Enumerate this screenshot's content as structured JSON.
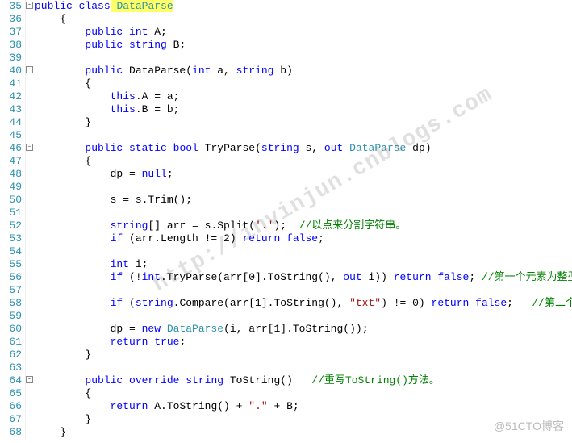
{
  "lines": {
    "l35": {
      "n": "35",
      "f": "⊟",
      "a": "public",
      "b": "class",
      "c": " DataParse"
    },
    "l36": {
      "n": "36",
      "t": "    {"
    },
    "l37": {
      "n": "37",
      "a": "        public",
      "b": "int",
      "c": " A;"
    },
    "l38": {
      "n": "38",
      "a": "        public",
      "b": "string",
      "c": " B;"
    },
    "l39": {
      "n": "39",
      "t": ""
    },
    "l40": {
      "n": "40",
      "f": "⊟",
      "a": "        public",
      "b": " DataParse(",
      "c": "int",
      "d": " a, ",
      "e": "string",
      "g": " b)"
    },
    "l41": {
      "n": "41",
      "t": "        {"
    },
    "l42": {
      "n": "42",
      "a": "            this",
      "b": ".A = a;"
    },
    "l43": {
      "n": "43",
      "a": "            this",
      "b": ".B = b;"
    },
    "l44": {
      "n": "44",
      "t": "        }"
    },
    "l45": {
      "n": "45",
      "t": ""
    },
    "l46": {
      "n": "46",
      "f": "⊟",
      "a": "        public",
      "b": "static",
      "c": "bool",
      "d": " TryParse(",
      "e": "string",
      "g": " s, ",
      "h": "out",
      "i": "DataParse",
      "j": " dp)"
    },
    "l47": {
      "n": "47",
      "t": "        {"
    },
    "l48": {
      "n": "48",
      "a": "            dp = ",
      "b": "null",
      "c": ";"
    },
    "l49": {
      "n": "49",
      "t": ""
    },
    "l50": {
      "n": "50",
      "t": "            s = s.Trim();"
    },
    "l51": {
      "n": "51",
      "t": ""
    },
    "l52": {
      "n": "52",
      "a": "            string",
      "b": "[] arr = s.Split(",
      "c": "'.'",
      "d": ");  ",
      "e": "//以点来分割字符串。"
    },
    "l53": {
      "n": "53",
      "a": "            if",
      "b": " (arr.Length != 2) ",
      "c": "return",
      "d": "false",
      "e": ";"
    },
    "l54": {
      "n": "54",
      "t": ""
    },
    "l55": {
      "n": "55",
      "a": "            int",
      "b": " i;"
    },
    "l56": {
      "n": "56",
      "a": "            if",
      "b": " (!",
      "c": "int",
      "d": ".TryParse(arr[0].ToString(), ",
      "e": "out",
      "g": " i)) ",
      "h": "return",
      "i": "false",
      "j": "; ",
      "k": "//第一个元素为整型。"
    },
    "l57": {
      "n": "57",
      "t": ""
    },
    "l58": {
      "n": "58",
      "a": "            if",
      "b": " (",
      "c": "string",
      "d": ".Compare(arr[1].ToString(), ",
      "e": "\"txt\"",
      "g": ") != 0) ",
      "h": "return",
      "i": "false",
      "j": ";   ",
      "k": "//第二个元素为\"txt\"。"
    },
    "l59": {
      "n": "59",
      "t": ""
    },
    "l60": {
      "n": "60",
      "a": "            dp = ",
      "b": "new",
      "c": "DataParse",
      "d": "(i, arr[1].ToString());"
    },
    "l61": {
      "n": "61",
      "a": "            return",
      "b": "true",
      "c": ";"
    },
    "l62": {
      "n": "62",
      "t": "        }"
    },
    "l63": {
      "n": "63",
      "t": ""
    },
    "l64": {
      "n": "64",
      "f": "⊟",
      "a": "        public",
      "b": "override",
      "c": "string",
      "d": " ToString()   ",
      "e": "//重写ToString()方法。"
    },
    "l65": {
      "n": "65",
      "t": "        {"
    },
    "l66": {
      "n": "66",
      "a": "            return",
      "b": " A.ToString() + ",
      "c": "\".\"",
      "d": " + B;"
    },
    "l67": {
      "n": "67",
      "t": "        }"
    },
    "l68": {
      "n": "68",
      "t": "    }"
    }
  },
  "watermark": "http://invinjun.cnblogs.com",
  "corner": "@51CTO博客"
}
